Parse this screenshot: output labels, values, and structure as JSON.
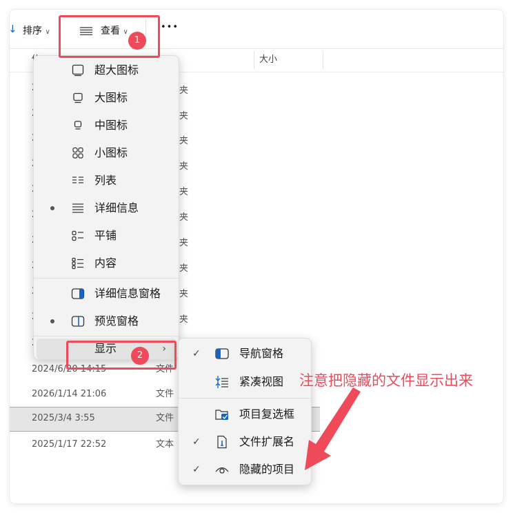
{
  "toolbar": {
    "sort_label": "排序",
    "view_label": "查看",
    "more_label": "•••"
  },
  "columns": {
    "first_partial": "修",
    "size": "大小"
  },
  "rows": [
    {
      "date": "2024/6/20 14:15",
      "type": "文件"
    },
    {
      "date": "2026/1/14 21:06",
      "type": "文件"
    },
    {
      "date": "2025/3/4 3:55",
      "type": "文件",
      "selected": true
    },
    {
      "date": "2025/1/17 22:52",
      "type": "文本"
    }
  ],
  "partial_left": [
    "2",
    "2",
    "2",
    "2",
    "2",
    "2",
    "2",
    "2",
    "2",
    "2",
    "2"
  ],
  "partial_right": [
    "夹",
    "夹",
    "夹",
    "夹",
    "夹",
    "夹",
    "夹",
    "夹",
    "夹",
    "夹"
  ],
  "view_menu": {
    "items": [
      {
        "label": "超大图标",
        "icon": "extra-large-icons-icon",
        "selected": false
      },
      {
        "label": "大图标",
        "icon": "large-icons-icon",
        "selected": false
      },
      {
        "label": "中图标",
        "icon": "medium-icons-icon",
        "selected": false
      },
      {
        "label": "小图标",
        "icon": "small-icons-icon",
        "selected": false
      },
      {
        "label": "列表",
        "icon": "list-icon",
        "selected": false
      },
      {
        "label": "详细信息",
        "icon": "details-icon",
        "selected": true
      },
      {
        "label": "平铺",
        "icon": "tiles-icon",
        "selected": false
      },
      {
        "label": "内容",
        "icon": "content-icon",
        "selected": false
      },
      {
        "label": "详细信息窗格",
        "icon": "details-pane-icon",
        "selected": false
      },
      {
        "label": "预览窗格",
        "icon": "preview-pane-icon",
        "selected": true
      },
      {
        "label": "显示",
        "icon": "",
        "has_submenu": true
      }
    ]
  },
  "show_submenu": {
    "items": [
      {
        "label": "导航窗格",
        "checked": true,
        "icon": "navigation-pane-icon"
      },
      {
        "label": "紧凑视图",
        "checked": false,
        "icon": "compact-view-icon"
      },
      {
        "label": "项目复选框",
        "checked": false,
        "icon": "item-checkbox-icon"
      },
      {
        "label": "文件扩展名",
        "checked": true,
        "icon": "file-extension-icon"
      },
      {
        "label": "隐藏的项目",
        "checked": true,
        "icon": "hidden-items-icon"
      }
    ]
  },
  "annotations": {
    "badge_1": "1",
    "badge_2": "2",
    "note": "注意把隐藏的文件显示出来",
    "accent_color": "#ee4a5a"
  }
}
